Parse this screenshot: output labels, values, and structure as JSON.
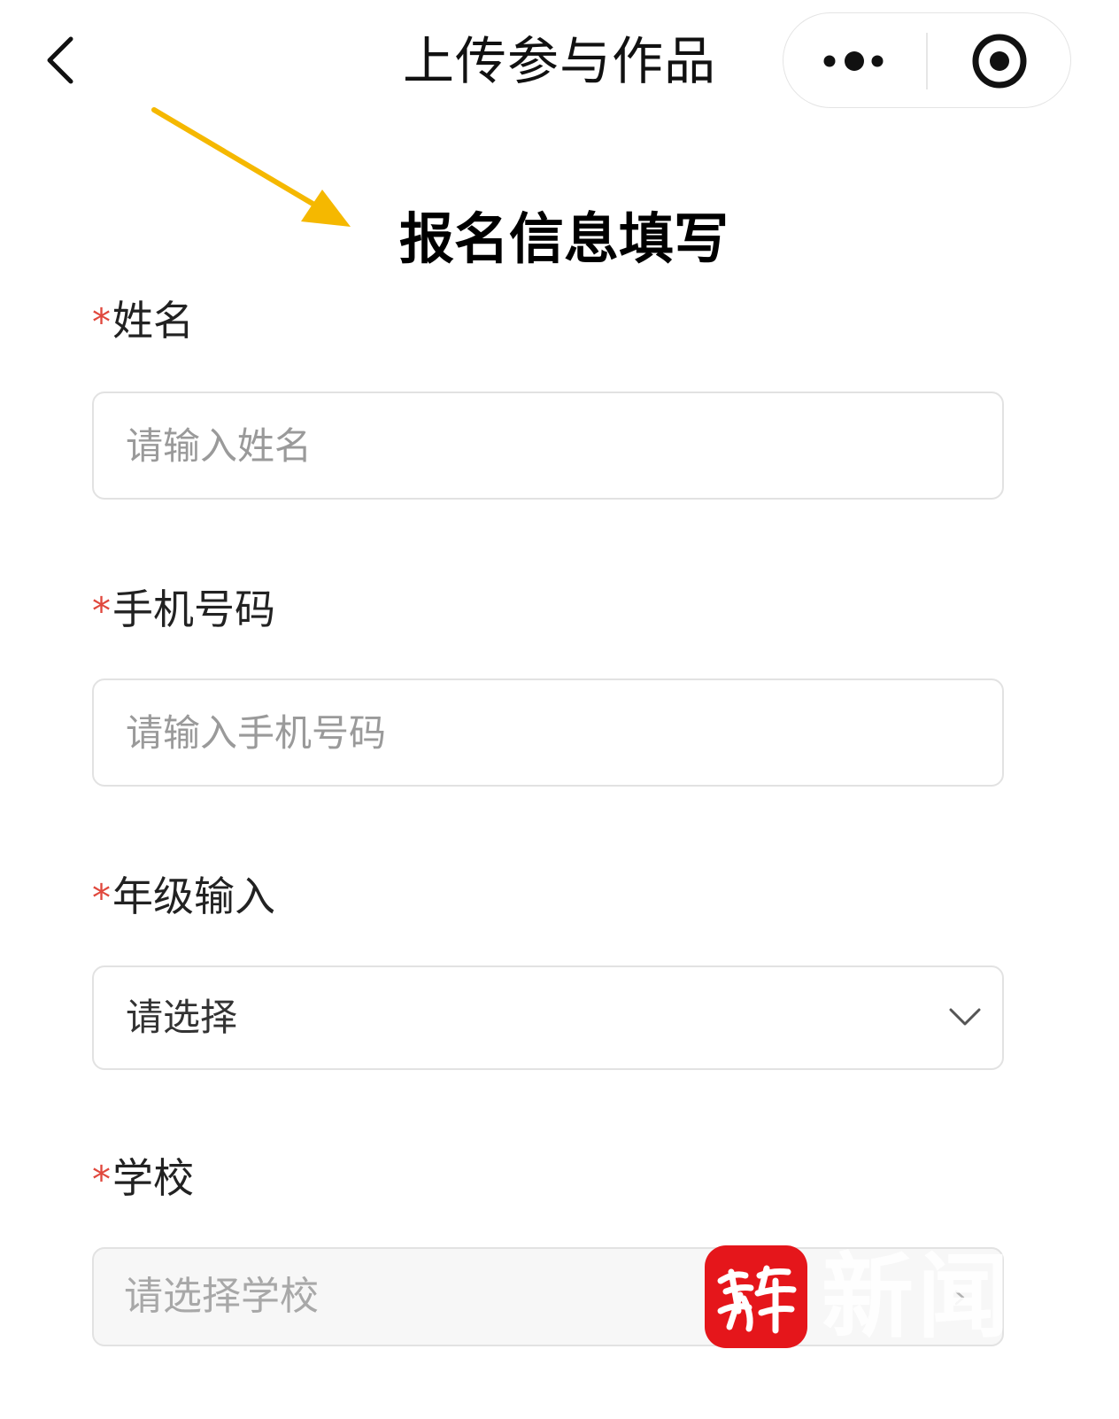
{
  "nav": {
    "title": "上传参与作品",
    "back_icon": "chevron-left-icon",
    "more_icon": "more-dots-icon",
    "close_icon": "target-close-icon"
  },
  "annotation": {
    "arrow_color": "#f5b800"
  },
  "form": {
    "heading": "报名信息填写",
    "required_mark": "*",
    "required_color": "#e0483d",
    "fields": [
      {
        "label": "姓名",
        "placeholder": "请输入姓名",
        "value": ""
      },
      {
        "label": "手机号码",
        "placeholder": "请输入手机号码",
        "value": ""
      },
      {
        "label": "年级输入",
        "selected": "请选择"
      },
      {
        "label": "学校",
        "selected": "请选择学校"
      }
    ]
  },
  "watermark": {
    "logo_text": "紫牛",
    "text": "新闻",
    "logo_color": "#e5161b"
  }
}
